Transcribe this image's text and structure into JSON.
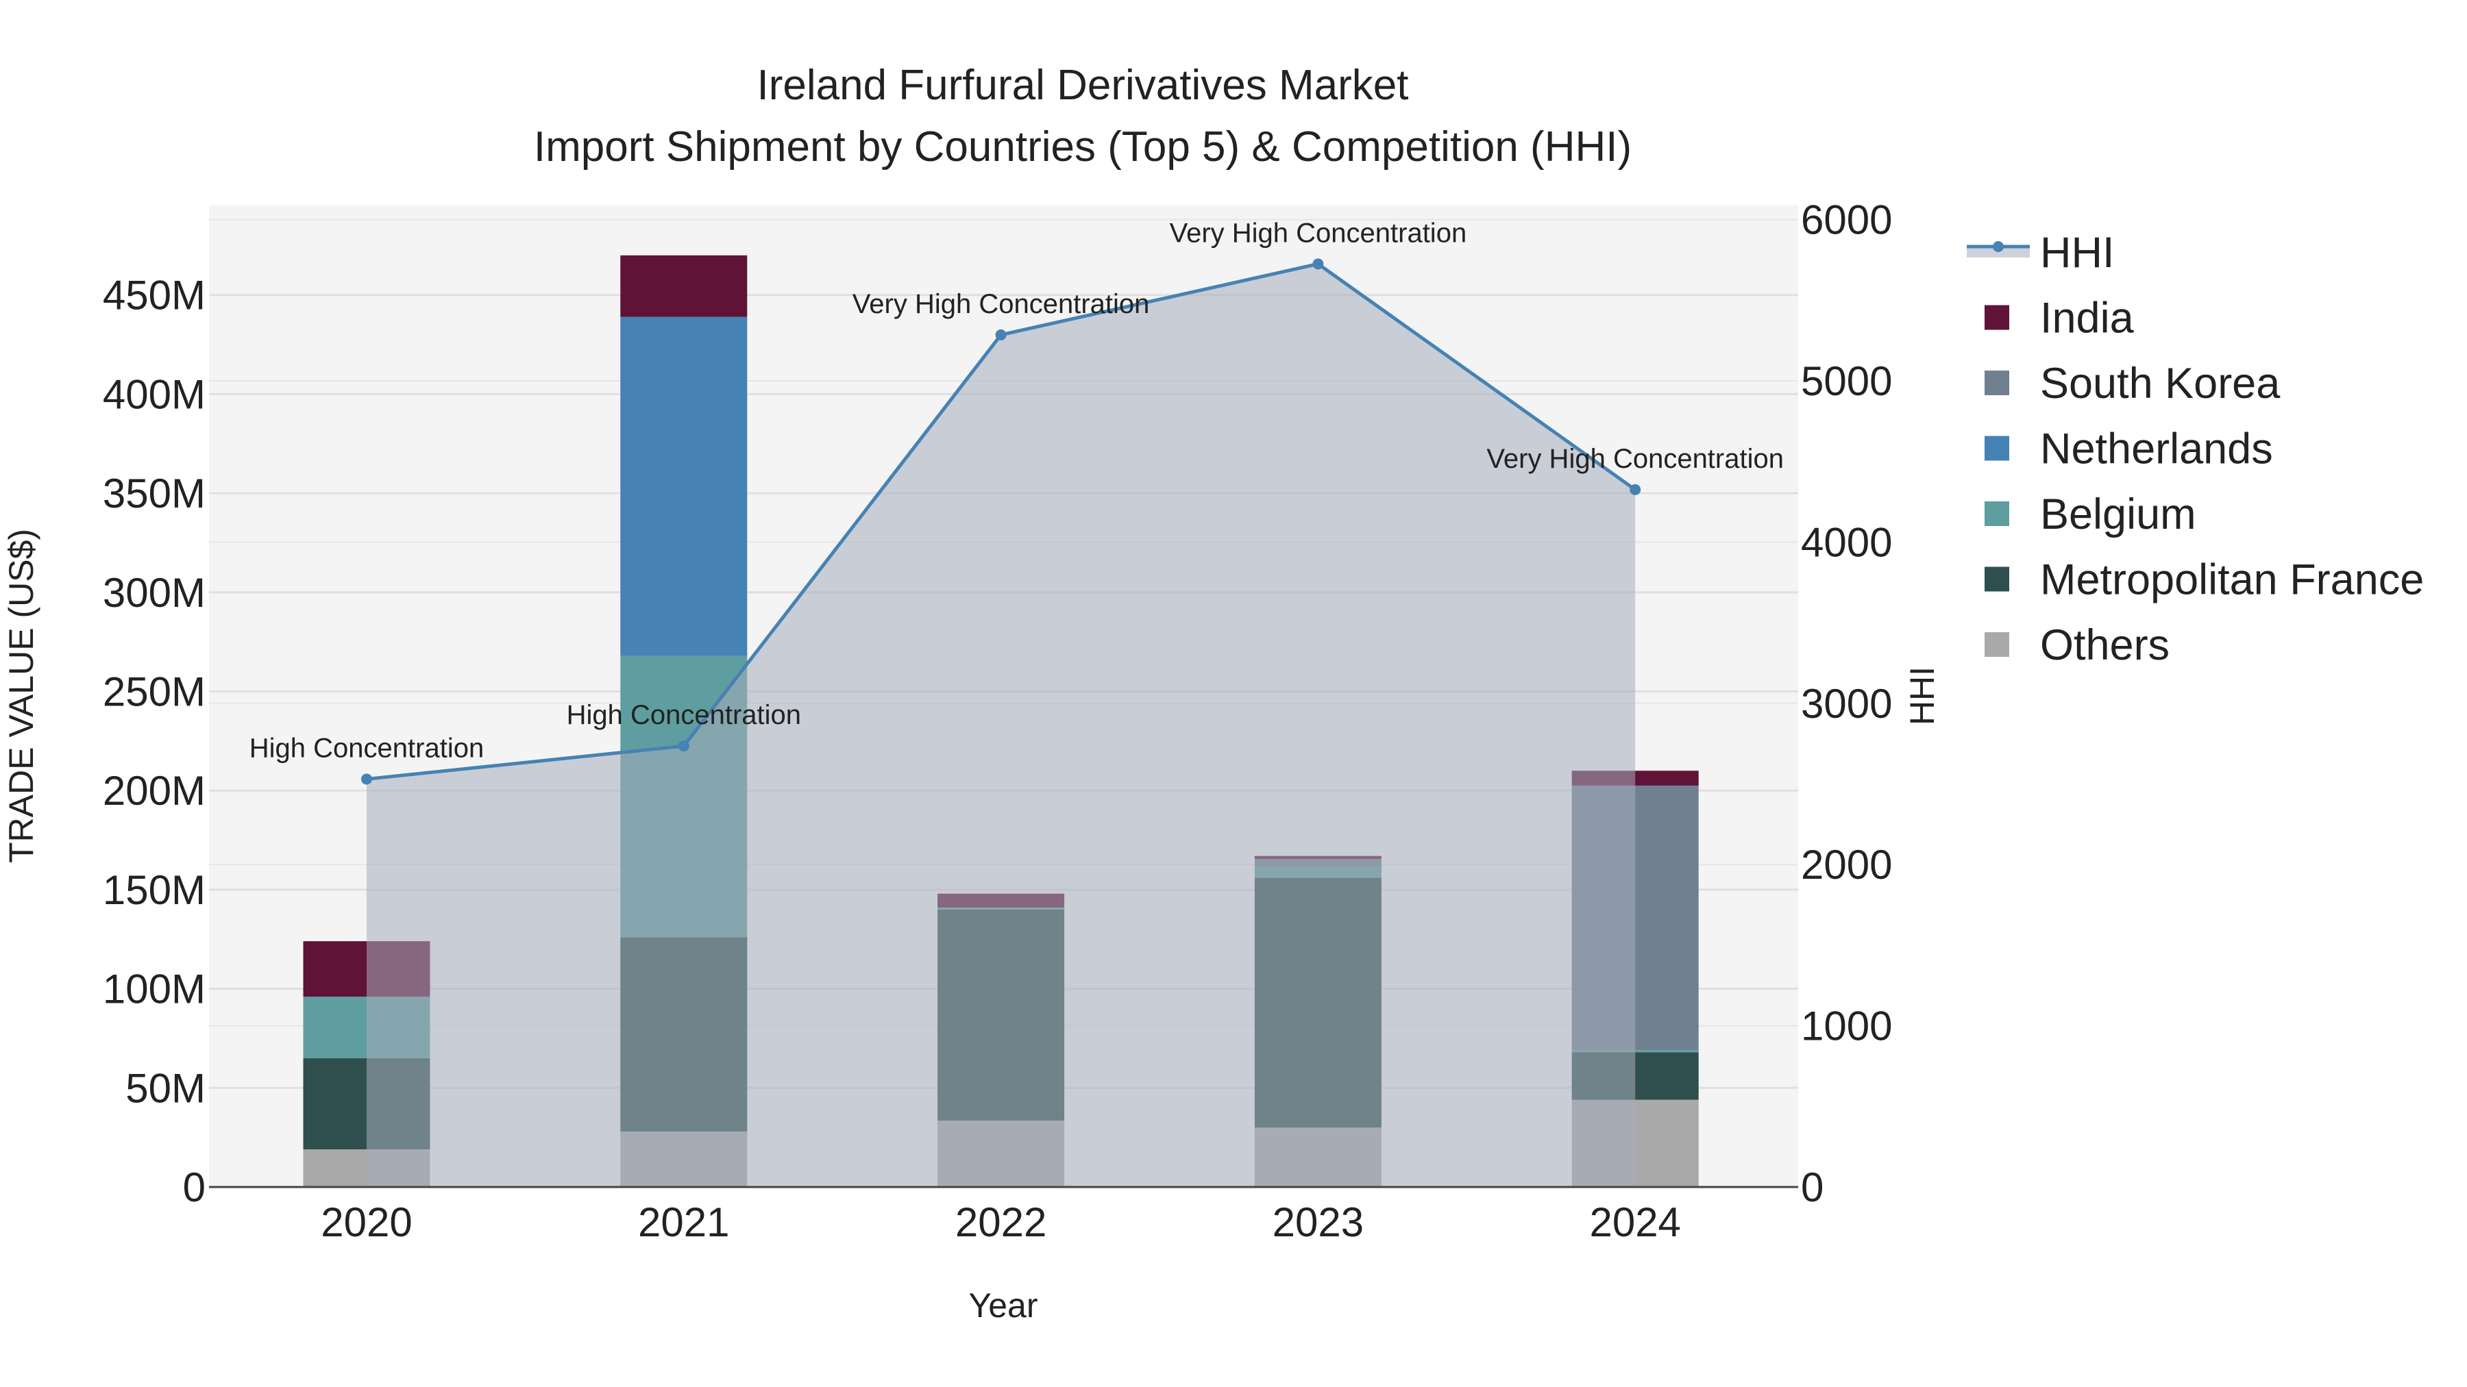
{
  "chart_data": {
    "type": "bar",
    "title_line1": "Ireland Furfural Derivatives Market",
    "title_line2": "Import Shipment by Countries (Top 5) & Competition (HHI)",
    "xlabel": "Year",
    "ylabel": "TRADE VALUE (US$)",
    "y2label": "HHI",
    "categories": [
      "2020",
      "2021",
      "2022",
      "2023",
      "2024"
    ],
    "ylim": [
      0,
      490000000
    ],
    "y_ticks": [
      0,
      50000000,
      100000000,
      150000000,
      200000000,
      250000000,
      300000000,
      350000000,
      400000000,
      450000000
    ],
    "y_tick_labels": [
      "0",
      "50M",
      "100M",
      "150M",
      "200M",
      "250M",
      "300M",
      "350M",
      "400M",
      "450M"
    ],
    "y2lim": [
      0,
      6000
    ],
    "y2_ticks": [
      0,
      1000,
      2000,
      3000,
      4000,
      5000,
      6000
    ],
    "y2_tick_labels": [
      "0",
      "1000",
      "2000",
      "3000",
      "4000",
      "5000",
      "6000"
    ],
    "grid": true,
    "legend_placement": "right",
    "series": [
      {
        "name": "Others",
        "color": "#a9a9a9",
        "values": [
          19000000,
          28000000,
          33500000,
          30000000,
          44000000
        ]
      },
      {
        "name": "Metropolitan France",
        "color": "#2f4f4f",
        "values": [
          46000000,
          98000000,
          106500000,
          126000000,
          24000000
        ]
      },
      {
        "name": "Belgium",
        "color": "#5f9ea0",
        "values": [
          31000000,
          142000000,
          1000000,
          5500000,
          1000000
        ]
      },
      {
        "name": "South Korea",
        "color": "#708090",
        "values": [
          0,
          0,
          0,
          4000000,
          133500000
        ]
      },
      {
        "name": "Netherlands",
        "color": "#4682b4",
        "values": [
          0,
          171000000,
          0,
          0,
          0
        ]
      },
      {
        "name": "India",
        "color": "#5f1336",
        "values": [
          28000000,
          31000000,
          7000000,
          1500000,
          7500000
        ]
      }
    ],
    "hhi": {
      "name": "HHI",
      "color": "#4682b4",
      "values": [
        2530,
        2735,
        5285,
        5725,
        4325
      ],
      "annotations": [
        "High Concentration",
        "High Concentration",
        "Very High Concentration",
        "Very High Concentration",
        "Very High Concentration"
      ]
    },
    "legend": [
      "HHI",
      "India",
      "South Korea",
      "Netherlands",
      "Belgium",
      "Metropolitan France",
      "Others"
    ]
  }
}
